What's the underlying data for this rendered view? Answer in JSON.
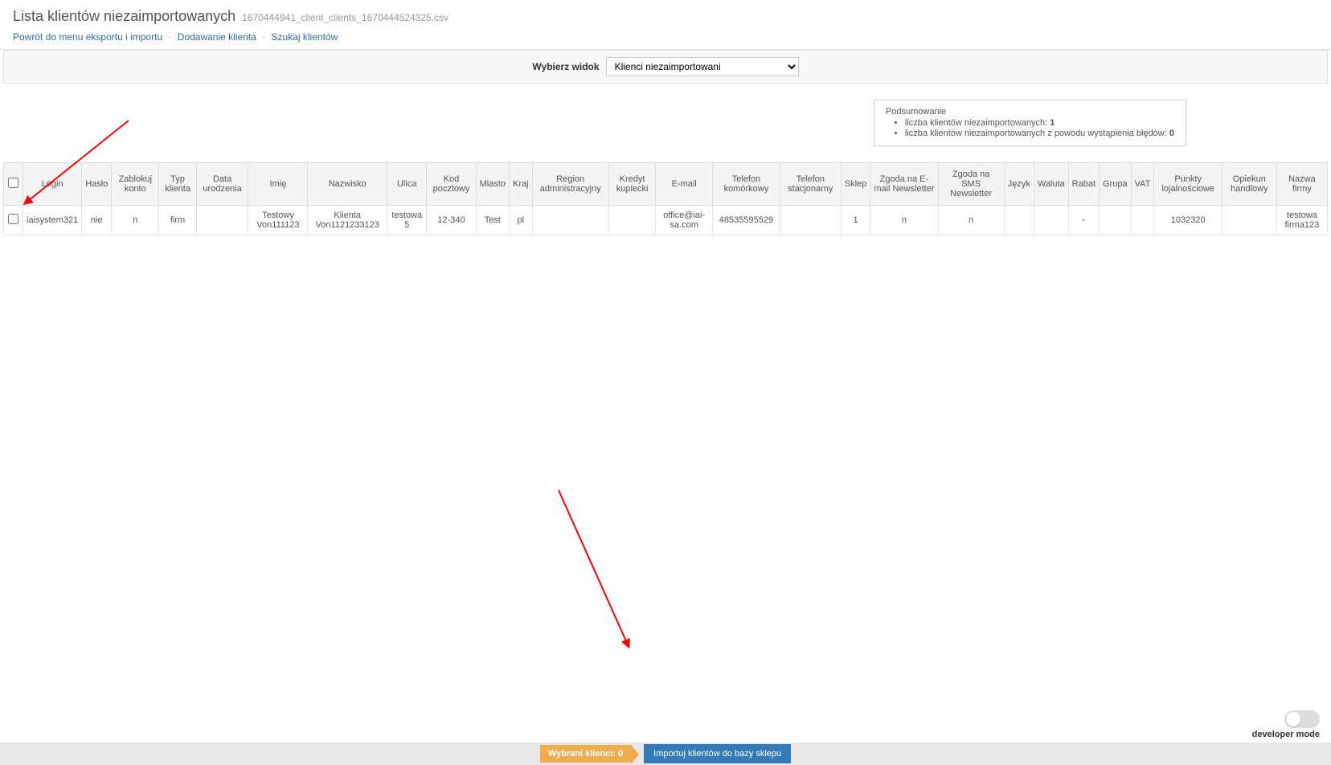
{
  "header": {
    "title": "Lista klientów niezaimportowanych",
    "filename": "1670444941_client_clients_1670444524325.csv"
  },
  "breadcrumb": {
    "link1": "Powrót do menu eksportu i importu",
    "link2": "Dodawanie klienta",
    "link3": "Szukaj klientów"
  },
  "view_selector": {
    "label": "Wybierz widok",
    "selected": "Klienci niezaimportowani"
  },
  "summary": {
    "title": "Podsumowanie",
    "not_imported_label": "liczba klientów niezaimportowanych:",
    "not_imported_count": "1",
    "errors_label": "liczba klientów niezaimportowanych z powodu wystąpienia błędów:",
    "errors_count": "0"
  },
  "table": {
    "headers": {
      "login": "Login",
      "haslo": "Hasło",
      "zablokuj": "Zablokuj konto",
      "typ": "Typ klienta",
      "data_ur": "Data urodzenia",
      "imie": "Imię",
      "nazwisko": "Nazwisko",
      "ulica": "Ulica",
      "kod": "Kod pocztowy",
      "miasto": "Miasto",
      "kraj": "Kraj",
      "region": "Region administracyjny",
      "kredyt": "Kredyt kupiecki",
      "email": "E-mail",
      "tel_kom": "Telefon komórkowy",
      "tel_stac": "Telefon stacjonarny",
      "sklep": "Sklep",
      "zgoda_email": "Zgoda na E-mail Newsletter",
      "zgoda_sms": "Zgoda na SMS Newsletter",
      "jezyk": "Język",
      "waluta": "Waluta",
      "rabat": "Rabat",
      "grupa": "Grupa",
      "vat": "VAT",
      "punkty": "Punkty lojalnościowe",
      "opiekun": "Opiekun handlowy",
      "nazwa_firmy": "Nazwa firmy"
    },
    "rows": [
      {
        "login": "iaisystem321",
        "haslo": "nie",
        "zablokuj": "n",
        "typ": "firm",
        "data_ur": "",
        "imie": "Testowy Von111123",
        "nazwisko": "Klienta Von1121233123",
        "ulica": "testowa 5",
        "kod": "12-340",
        "miasto": "Test",
        "kraj": "pl",
        "region": "",
        "kredyt": "",
        "email": "office@iai-sa.com",
        "tel_kom": "48535595529",
        "tel_stac": "",
        "sklep": "1",
        "zgoda_email": "n",
        "zgoda_sms": "n",
        "jezyk": "",
        "waluta": "",
        "rabat": "-",
        "grupa": "",
        "vat": "",
        "punkty": "1032320",
        "opiekun": "",
        "nazwa_firmy": "testowa firma123"
      }
    ]
  },
  "footer": {
    "selected_label": "Wybrani klienci: 0",
    "import_label": "Importuj klientów do bazy sklepu"
  },
  "dev_mode": {
    "label": "developer mode"
  }
}
